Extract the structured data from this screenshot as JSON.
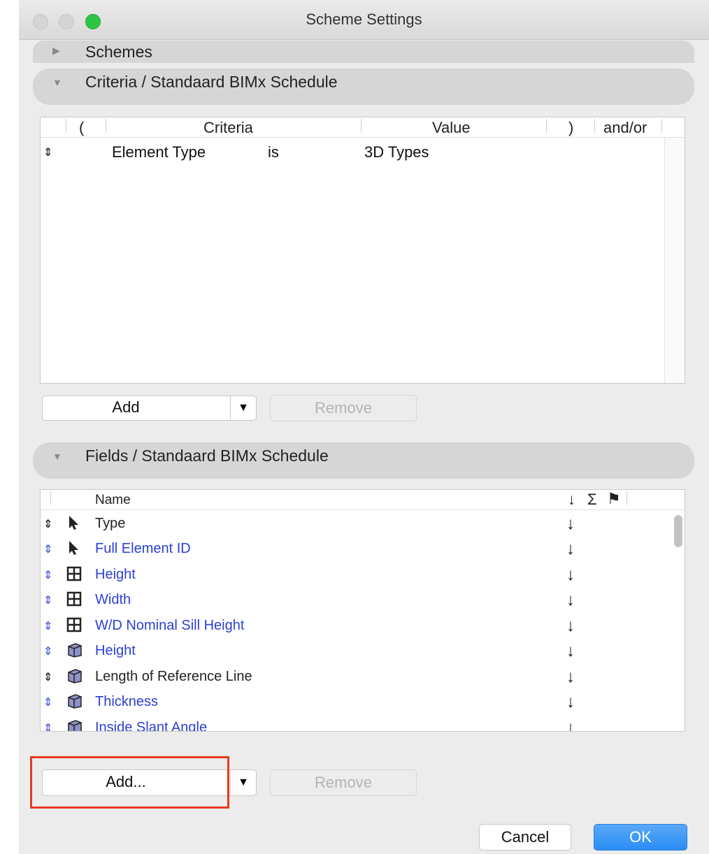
{
  "window": {
    "title": "Scheme Settings"
  },
  "schemes_section": {
    "label": "Schemes"
  },
  "criteria_section": {
    "label": "Criteria /  Standaard BIMx Schedule",
    "columns": {
      "open_paren": "(",
      "criteria": "Criteria",
      "value": "Value",
      "close_paren": ")",
      "andor": "and/or"
    },
    "rows": [
      {
        "criteria": "Element Type",
        "operator": "is",
        "value": "3D Types"
      }
    ],
    "add_label": "Add",
    "remove_label": "Remove"
  },
  "fields_section": {
    "label": "Fields /  Standaard BIMx Schedule",
    "column_name": "Name",
    "sort_icon": "↓",
    "sum_icon": "Σ",
    "flag_icon": "⚑",
    "rows": [
      {
        "name": "Type",
        "icon": "cursor-icon",
        "color": "black"
      },
      {
        "name": "Full Element ID",
        "icon": "cursor-icon",
        "color": "blue"
      },
      {
        "name": "Height",
        "icon": "window-icon",
        "color": "blue"
      },
      {
        "name": "Width",
        "icon": "window-icon",
        "color": "blue"
      },
      {
        "name": "W/D Nominal Sill Height",
        "icon": "window-icon",
        "color": "blue"
      },
      {
        "name": "Height",
        "icon": "wall-icon",
        "color": "blue"
      },
      {
        "name": "Length of Reference Line",
        "icon": "wall-icon",
        "color": "black"
      },
      {
        "name": "Thickness",
        "icon": "wall-icon",
        "color": "blue"
      },
      {
        "name": "Inside Slant Angle",
        "icon": "wall-icon",
        "color": "blue"
      }
    ],
    "add_label": "Add...",
    "remove_label": "Remove"
  },
  "footer": {
    "cancel_label": "Cancel",
    "ok_label": "OK"
  },
  "colors": {
    "accent": "#2a8df5",
    "highlight_box": "#e63b1e",
    "link_blue": "#2c3fd6"
  }
}
